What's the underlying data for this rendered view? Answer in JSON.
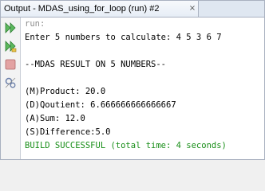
{
  "window": {
    "tab_title": "Output - MDAS_using_for_loop (run) #2",
    "close_glyph": "×"
  },
  "toolbar": {
    "buttons": [
      {
        "icon": "rerun-icon",
        "color": "#4caf50"
      },
      {
        "icon": "rerun-with-options-icon",
        "color": "#4caf50"
      },
      {
        "icon": "stop-icon",
        "color": "#d9534f"
      },
      {
        "icon": "settings-icon",
        "color": "#6b7fa8"
      }
    ]
  },
  "console": {
    "lines": [
      {
        "text": "run:",
        "style": "gray"
      },
      {
        "text": "Enter 5 numbers to calculate: 4 5 3 6 7",
        "style": "normal"
      },
      {
        "text": "",
        "style": "normal"
      },
      {
        "text": "--MDAS RESULT ON 5 NUMBERS--",
        "style": "normal"
      },
      {
        "text": "",
        "style": "normal"
      },
      {
        "text": "(M)Product: 20.0",
        "style": "normal"
      },
      {
        "text": "(D)Qoutient: 6.666666666666667",
        "style": "normal"
      },
      {
        "text": "(A)Sum: 12.0",
        "style": "normal"
      },
      {
        "text": "(S)Difference:5.0",
        "style": "normal"
      },
      {
        "text": "BUILD SUCCESSFUL (total time: 4 seconds)",
        "style": "green"
      }
    ]
  }
}
